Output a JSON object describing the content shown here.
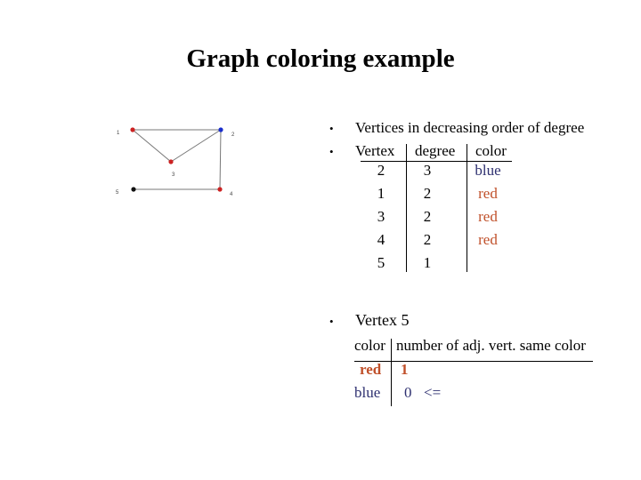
{
  "title": "Graph coloring example",
  "graph": {
    "vertices": [
      {
        "id": "1",
        "color": "#cc2222"
      },
      {
        "id": "2",
        "color": "#1a2ecc"
      },
      {
        "id": "3",
        "color": "#cc2222"
      },
      {
        "id": "4",
        "color": "#cc2222"
      },
      {
        "id": "5",
        "color": "#111111"
      }
    ],
    "edges": [
      [
        "1",
        "2"
      ],
      [
        "1",
        "3"
      ],
      [
        "3",
        "2"
      ],
      [
        "2",
        "4"
      ],
      [
        "5",
        "4"
      ]
    ]
  },
  "bullets": {
    "b1": "Vertices in decreasing order of degree",
    "bullet_char": "•"
  },
  "degree_table": {
    "headers": [
      "Vertex",
      "degree",
      "color"
    ],
    "rows": [
      {
        "vertex": "2",
        "degree": "3",
        "color": "blue"
      },
      {
        "vertex": "1",
        "degree": "2",
        "color": "red"
      },
      {
        "vertex": "3",
        "degree": "2",
        "color": "red"
      },
      {
        "vertex": "4",
        "degree": "2",
        "color": "red"
      },
      {
        "vertex": "5",
        "degree": "1",
        "color": ""
      }
    ]
  },
  "vertex5": {
    "label": "Vertex 5",
    "headers": [
      "color",
      "number of adj. vert. same color"
    ],
    "rows": [
      {
        "color": "red",
        "count": "1",
        "marker": ""
      },
      {
        "color": "blue",
        "count": "0",
        "marker": "<="
      }
    ]
  },
  "colors": {
    "blue": "#2e3070",
    "red": "#c0502a"
  }
}
